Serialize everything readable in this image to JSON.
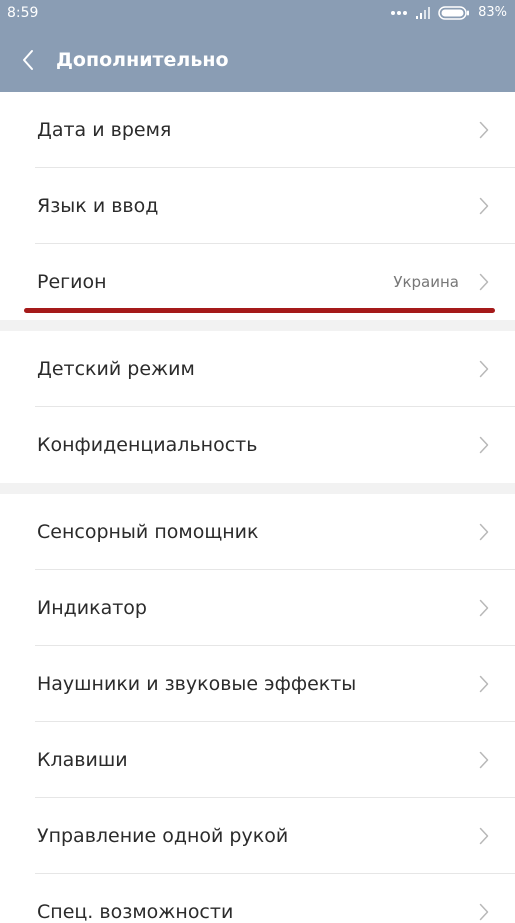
{
  "status_bar": {
    "time": "8:59",
    "battery_percent": "83%",
    "icons": [
      "dots-icon",
      "signal-icon",
      "battery-icon"
    ]
  },
  "header": {
    "title": "Дополнительно",
    "back_icon": "chevron-left-icon",
    "background_color": "#8a9db4"
  },
  "sections": [
    {
      "items": [
        {
          "label": "Дата и время"
        },
        {
          "label": "Язык и ввод"
        },
        {
          "label": "Регион",
          "value": "Украина"
        }
      ]
    },
    {
      "items": [
        {
          "label": "Детский режим"
        },
        {
          "label": "Конфиденциальность"
        }
      ]
    },
    {
      "items": [
        {
          "label": "Сенсорный помощник"
        },
        {
          "label": "Индикатор"
        },
        {
          "label": "Наушники и звуковые эффекты"
        },
        {
          "label": "Клавиши"
        },
        {
          "label": "Управление одной рукой"
        },
        {
          "label": "Спец. возможности"
        }
      ]
    }
  ],
  "row_icon": "chevron-right-icon",
  "annotation": {
    "color": "#a51a1a"
  }
}
